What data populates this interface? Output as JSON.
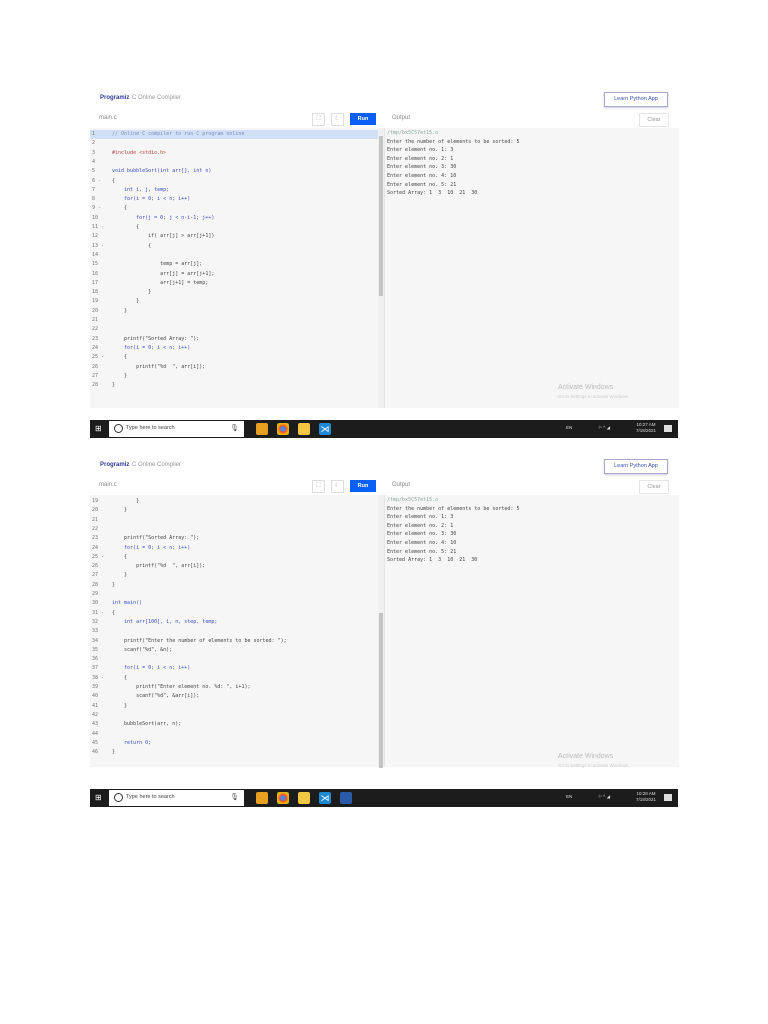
{
  "shots": [
    {
      "logo": "Programiz",
      "app_title": "C Online Compiler",
      "learn_button": "Learn Python App",
      "file_tab": "main.c",
      "run_button": "Run",
      "output_label": "Output",
      "clear_button": "Clear",
      "code_start_line": 1,
      "fold_lines": [
        6,
        9,
        11,
        13,
        25
      ],
      "highlight_line": 1,
      "code": [
        "// Online C compiler to run C program online",
        "",
        "#include <stdio.h>",
        "",
        "void bubbleSort(int arr[], int n)",
        "{",
        "    int i, j, temp;",
        "    for(i = 0; i < n; i++)",
        "    {",
        "        for(j = 0; j < n-i-1; j++)",
        "        {",
        "            if( arr[j] > arr[j+1])",
        "            {",
        "",
        "                temp = arr[j];",
        "                arr[j] = arr[j+1];",
        "                arr[j+1] = temp;",
        "            }",
        "        }",
        "    }",
        "",
        "",
        "    printf(\"Sorted Array: \");",
        "    for(i = 0; i < n; i++)",
        "    {",
        "        printf(\"%d  \", arr[i]);",
        "    }",
        "}"
      ],
      "output": [
        "/tmp/bx5C57et15.o",
        "Enter the number of elements to be sorted: 5",
        "Enter element no. 1: 3",
        "Enter element no. 2: 1",
        "Enter element no. 3: 30",
        "Enter element no. 4: 10",
        "Enter element no. 5: 21",
        "Sorted Array: 1  3  10  21  30"
      ],
      "activate_title": "Activate Windows",
      "activate_sub": "Go to Settings to activate Windows.",
      "taskbar": {
        "search_placeholder": "Type here to search",
        "lang": "EN",
        "time": "10:27 AM",
        "date": "7/18/2021"
      }
    },
    {
      "logo": "Programiz",
      "app_title": "C Online Compiler",
      "learn_button": "Learn Python App",
      "file_tab": "main.c",
      "run_button": "Run",
      "output_label": "Output",
      "clear_button": "Clear",
      "code_start_line": 19,
      "fold_lines": [
        25,
        31,
        38
      ],
      "highlight_line": 0,
      "code": [
        "        }",
        "    }",
        "",
        "",
        "    printf(\"Sorted Array: \");",
        "    for(i = 0; i < n; i++)",
        "    {",
        "        printf(\"%d  \", arr[i]);",
        "    }",
        "}",
        "",
        "int main()",
        "{",
        "    int arr[100], i, n, step, temp;",
        "",
        "    printf(\"Enter the number of elements to be sorted: \");",
        "    scanf(\"%d\", &n);",
        "",
        "    for(i = 0; i < n; i++)",
        "    {",
        "        printf(\"Enter element no. %d: \", i+1);",
        "        scanf(\"%d\", &arr[i]);",
        "    }",
        "",
        "    bubbleSort(arr, n);",
        "",
        "    return 0;",
        "}"
      ],
      "output": [
        "/tmp/bx5C57et15.o",
        "Enter the number of elements to be sorted: 5",
        "Enter element no. 1: 3",
        "Enter element no. 2: 1",
        "Enter element no. 3: 30",
        "Enter element no. 4: 10",
        "Enter element no. 5: 21",
        "Sorted Array: 1  3  10  21  30"
      ],
      "activate_title": "Activate Windows",
      "activate_sub": "Go to Settings to activate Windows.",
      "taskbar": {
        "search_placeholder": "Type here to search",
        "lang": "EN",
        "time": "10:28 AM",
        "date": "7/18/2021"
      }
    }
  ]
}
